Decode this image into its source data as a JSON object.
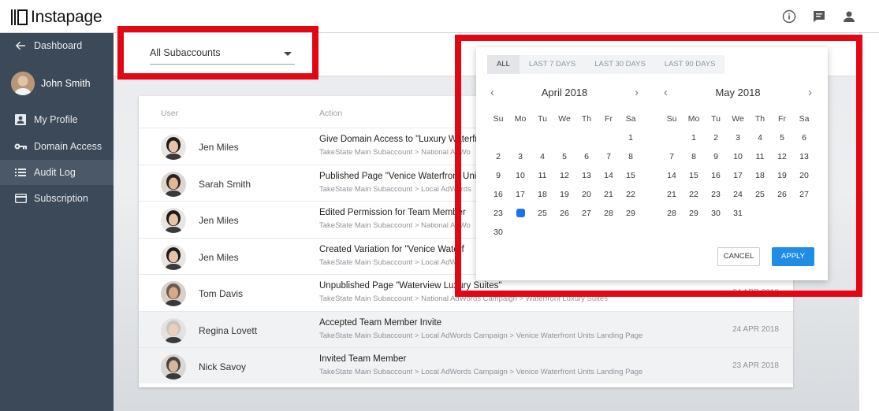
{
  "app": {
    "name": "Instapage"
  },
  "sidebar": {
    "back_label": "Dashboard",
    "user_name": "John Smith",
    "items": [
      {
        "label": "My Profile",
        "icon": "profile-icon"
      },
      {
        "label": "Domain Access",
        "icon": "key-icon"
      },
      {
        "label": "Audit Log",
        "icon": "list-icon",
        "active": true
      },
      {
        "label": "Subscription",
        "icon": "card-icon"
      }
    ]
  },
  "filter": {
    "subaccount_value": "All Subaccounts"
  },
  "table": {
    "columns": [
      "User",
      "Action"
    ],
    "rows": [
      {
        "user": "Jen Miles",
        "action": "Give Domain Access to \"Luxury Waterfr",
        "path": "TakeState Main Subaccount > National AdWo",
        "date": ""
      },
      {
        "user": "Sarah Smith",
        "action": "Published Page \"Venice Waterfront Units",
        "path": "TakeState Main Subaccount > Local AdWords",
        "date": ""
      },
      {
        "user": "Jen Miles",
        "action": "Edited Permission for Team Member",
        "path": "TakeState Main Subaccount > National AdWo",
        "date": ""
      },
      {
        "user": "Jen Miles",
        "action": "Created Variation for \"Venice Waterf",
        "path": "TakeState Main Subaccount > Local AdWo",
        "date": ""
      },
      {
        "user": "Tom Davis",
        "action": "Unpublished Page \"Waterview Luxury Suites\"",
        "path": "TakeState Main Subaccount > National AdWords Campaign > Waterfront Luxury Suites",
        "date": "24 APR 2018"
      },
      {
        "user": "Regina Lovett",
        "action": "Accepted Team Member Invite",
        "path": "TakeState Main Subaccount > Local AdWords Campaign > Venice Waterfront Units Landing Page",
        "date": "24 APR 2018"
      },
      {
        "user": "Nick Savoy",
        "action": "Invited Team Member",
        "path": "TakeState Main Subaccount > Local AdWords Campaign > Venice Waterfront Units Landing Page",
        "date": "23 APR 2018"
      }
    ]
  },
  "datepicker": {
    "presets": [
      "ALL",
      "LAST 7 DAYS",
      "LAST 30 DAYS",
      "LAST 90 DAYS"
    ],
    "selected_preset": "ALL",
    "weekdays": [
      "Su",
      "Mo",
      "Tu",
      "We",
      "Th",
      "Fr",
      "Sa"
    ],
    "months": [
      {
        "title": "April 2018",
        "offset": 6,
        "days": 30,
        "today": 24
      },
      {
        "title": "May 2018",
        "offset": 1,
        "days": 31,
        "today": 0
      }
    ],
    "cancel_label": "CANCEL",
    "apply_label": "APPLY"
  },
  "colors": {
    "sidebar": "#3c4959",
    "accent": "#1f8ce6",
    "highlight": "#e30613"
  }
}
